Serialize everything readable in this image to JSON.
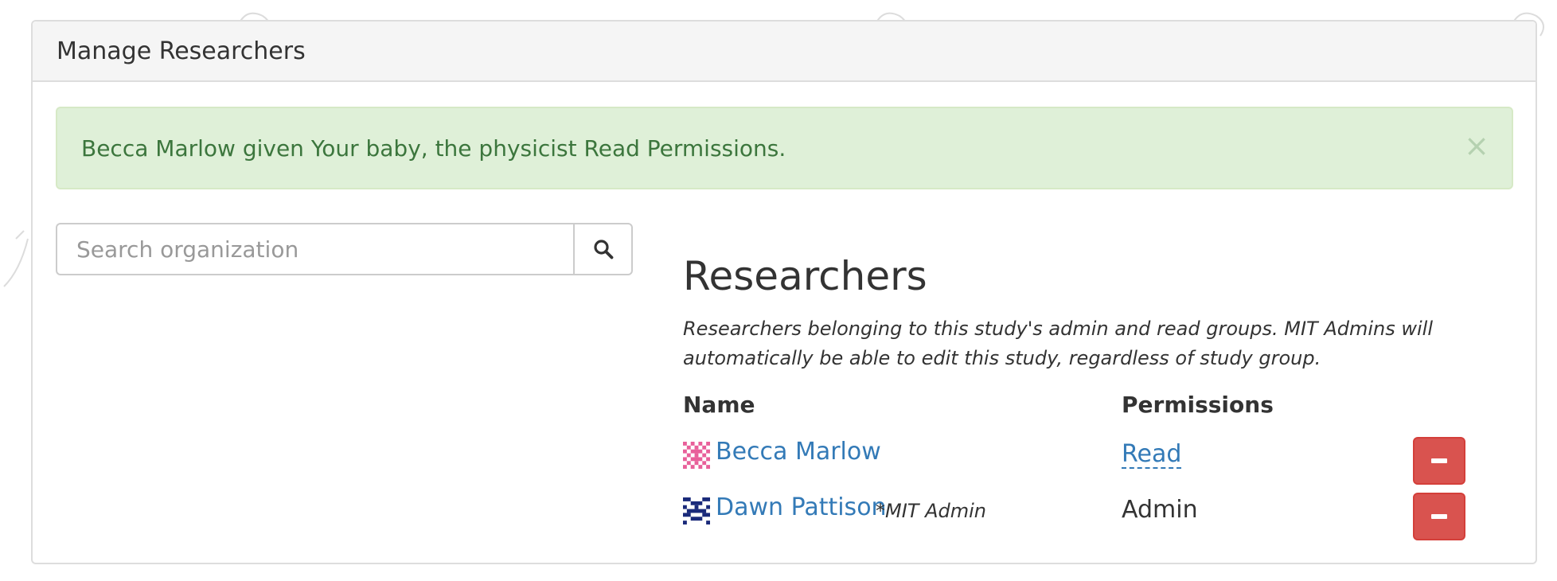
{
  "panel": {
    "title": "Manage Researchers"
  },
  "alert": {
    "message": "Becca Marlow given Your baby, the physicist Read Permissions.",
    "close_label": "×"
  },
  "search": {
    "placeholder": "Search organization",
    "value": "",
    "icon": "search-icon"
  },
  "researchers": {
    "title": "Researchers",
    "description": "Researchers belonging to this study's admin and read groups. MIT Admins will automatically be able to edit this study, regardless of study group.",
    "headers": {
      "name": "Name",
      "permissions": "Permissions"
    },
    "rows": [
      {
        "name": "Becca Marlow",
        "note": "",
        "permission": "Read",
        "permission_editable": true,
        "avatar_color": "#e8609a"
      },
      {
        "name": "Dawn Pattison",
        "note": "*MIT Admin",
        "permission": "Admin",
        "permission_editable": false,
        "avatar_color": "#1a2a7a"
      }
    ]
  },
  "colors": {
    "alert_bg": "#dff0d8",
    "alert_text": "#3c763d",
    "link": "#337ab7",
    "danger": "#d9534f"
  }
}
